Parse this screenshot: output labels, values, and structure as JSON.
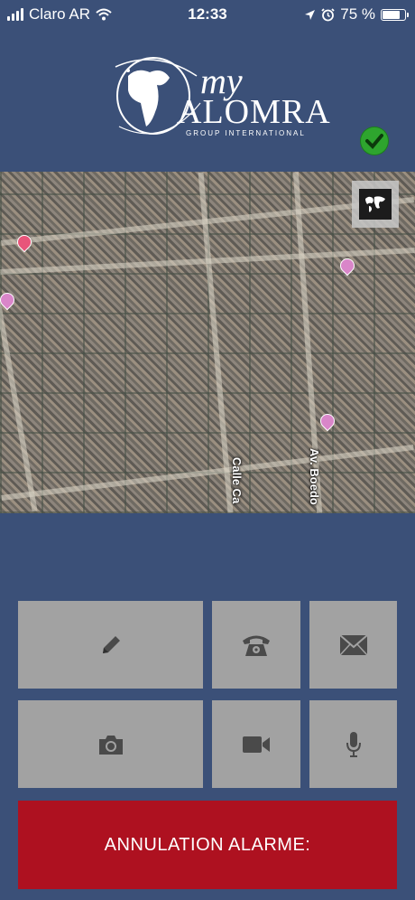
{
  "status_bar": {
    "carrier": "Claro AR",
    "time": "12:33",
    "battery_percent": "75 %",
    "battery_level": 0.75
  },
  "logo": {
    "my": "my",
    "brand": "ALOMRA",
    "subtitle": "GROUP INTERNATIONAL"
  },
  "connection_status": {
    "icon": "check-circle-icon",
    "color": "#2ea52e"
  },
  "map": {
    "labels": [
      "Calle Ca",
      "Av. Boedo"
    ],
    "toggle_icon": "world-map-icon"
  },
  "actions": [
    {
      "name": "write",
      "icon": "pencil-icon"
    },
    {
      "name": "call",
      "icon": "telephone-icon"
    },
    {
      "name": "email",
      "icon": "envelope-icon"
    },
    {
      "name": "photo",
      "icon": "camera-icon"
    },
    {
      "name": "video",
      "icon": "video-camera-icon"
    },
    {
      "name": "audio",
      "icon": "microphone-icon"
    }
  ],
  "alarm": {
    "label": "ANNULATION ALARME:",
    "color": "#ae1120"
  }
}
